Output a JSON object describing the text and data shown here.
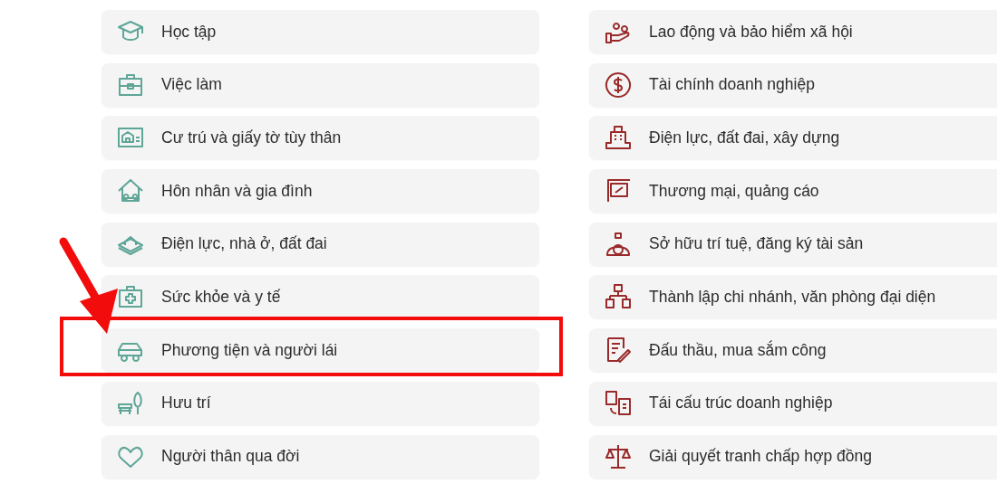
{
  "left_items": [
    {
      "label": "Học tập"
    },
    {
      "label": "Việc làm"
    },
    {
      "label": "Cư trú và giấy tờ tùy thân"
    },
    {
      "label": "Hôn nhân và gia đình"
    },
    {
      "label": "Điện lực, nhà ở, đất đai"
    },
    {
      "label": "Sức khỏe và y tế"
    },
    {
      "label": "Phương tiện và người lái",
      "annotation": {
        "kind": "frame-with-arrow"
      }
    },
    {
      "label": "Hưu trí"
    },
    {
      "label": "Người thân qua đời"
    }
  ],
  "right_items": [
    {
      "label": "Lao động và bảo hiểm xã hội"
    },
    {
      "label": "Tài chính doanh nghiệp"
    },
    {
      "label": "Điện lực, đất đai, xây dựng"
    },
    {
      "label": "Thương mại, quảng cáo"
    },
    {
      "label": "Sở hữu trí tuệ, đăng ký tài sản"
    },
    {
      "label": "Thành lập chi nhánh, văn phòng đại diện"
    },
    {
      "label": "Đấu thầu, mua sắm công"
    },
    {
      "label": "Tái cấu trúc doanh nghiệp"
    },
    {
      "label": "Giải quyết tranh chấp hợp đồng"
    }
  ]
}
